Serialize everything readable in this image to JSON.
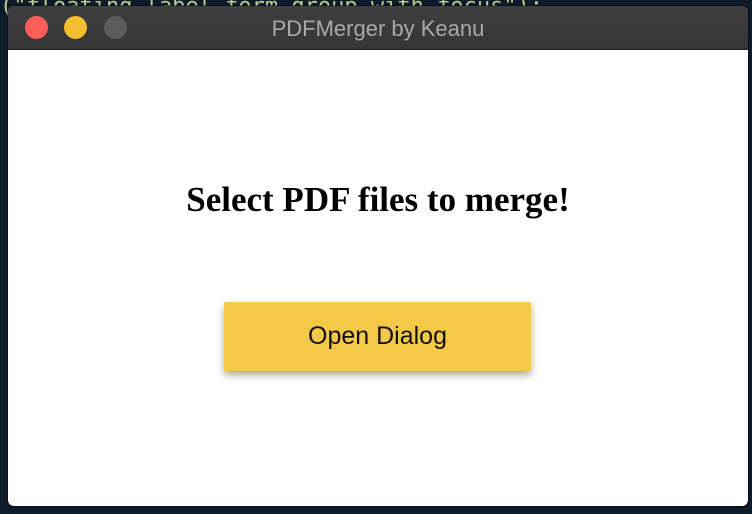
{
  "background": {
    "code_text": "(\"floating-label-form-group-with-focus\");"
  },
  "window": {
    "title": "PDFMerger by Keanu",
    "controls": {
      "close_color": "#ff5f57",
      "minimize_color": "#f4bf2f",
      "maximize_color": "#5c5c5c"
    }
  },
  "main": {
    "heading": "Select PDF files to merge!",
    "open_button_label": "Open Dialog",
    "accent_color": "#f4c947"
  }
}
